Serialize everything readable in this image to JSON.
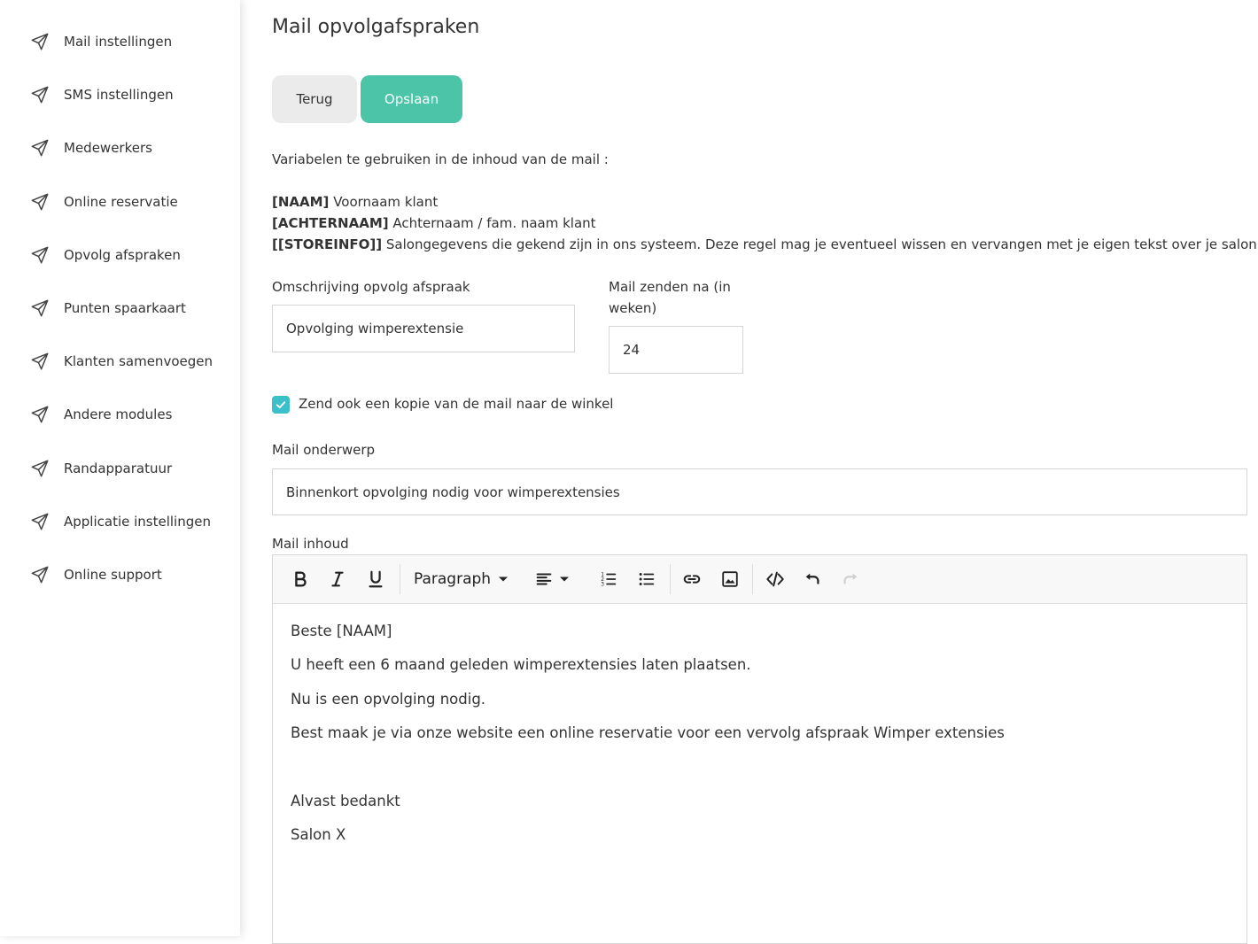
{
  "sidebar": {
    "items": [
      {
        "label": "Mail instellingen"
      },
      {
        "label": "SMS instellingen"
      },
      {
        "label": "Medewerkers"
      },
      {
        "label": "Online reservatie"
      },
      {
        "label": "Opvolg afspraken"
      },
      {
        "label": "Punten spaarkaart"
      },
      {
        "label": "Klanten samenvoegen"
      },
      {
        "label": "Andere modules"
      },
      {
        "label": "Randapparatuur"
      },
      {
        "label": "Applicatie instellingen"
      },
      {
        "label": "Online support"
      }
    ],
    "icon": "paper-plane-icon"
  },
  "page": {
    "title": "Mail opvolgafspraken",
    "back_label": "Terug",
    "save_label": "Opslaan",
    "accent_color": "#4cc4a8",
    "checkbox_color": "#3bbfc8"
  },
  "variables": {
    "intro": "Variabelen te gebruiken in de inhoud van de mail :",
    "items": [
      {
        "tag": "[NAAM]",
        "desc": " Voornaam klant"
      },
      {
        "tag": "[ACHTERNAAM]",
        "desc": " Achternaam / fam. naam klant"
      },
      {
        "tag": "[[STOREINFO]]",
        "desc": " Salongegevens die gekend zijn in ons systeem. Deze regel mag je eventueel wissen en vervangen met je eigen tekst over je salon."
      }
    ]
  },
  "form": {
    "description_label": "Omschrijving opvolg afspraak",
    "description_value": "Opvolging wimperextensie",
    "weeks_label_line1": "Mail zenden na (in",
    "weeks_label_line2": "weken)",
    "weeks_value": "24",
    "copy_checked": true,
    "copy_label": "Zend ook een kopie van de mail naar de winkel",
    "subject_label": "Mail onderwerp",
    "subject_value": "Binnenkort opvolging nodig voor wimperextensies",
    "content_label": "Mail inhoud"
  },
  "editor": {
    "block_format": "Paragraph",
    "toolbar_icons": [
      "bold-icon",
      "italic-icon",
      "underline-icon",
      "align-left-icon",
      "ordered-list-icon",
      "bullet-list-icon",
      "link-icon",
      "image-icon",
      "code-icon",
      "undo-icon",
      "redo-icon"
    ],
    "paragraphs": [
      "Beste [NAAM]",
      "U heeft een 6 maand geleden wimperextensies laten plaatsen.",
      "Nu is een opvolging nodig.",
      "Best maak je via onze website een online reservatie voor een vervolg afspraak Wimper extensies",
      "",
      "Alvast bedankt",
      "Salon X"
    ]
  }
}
